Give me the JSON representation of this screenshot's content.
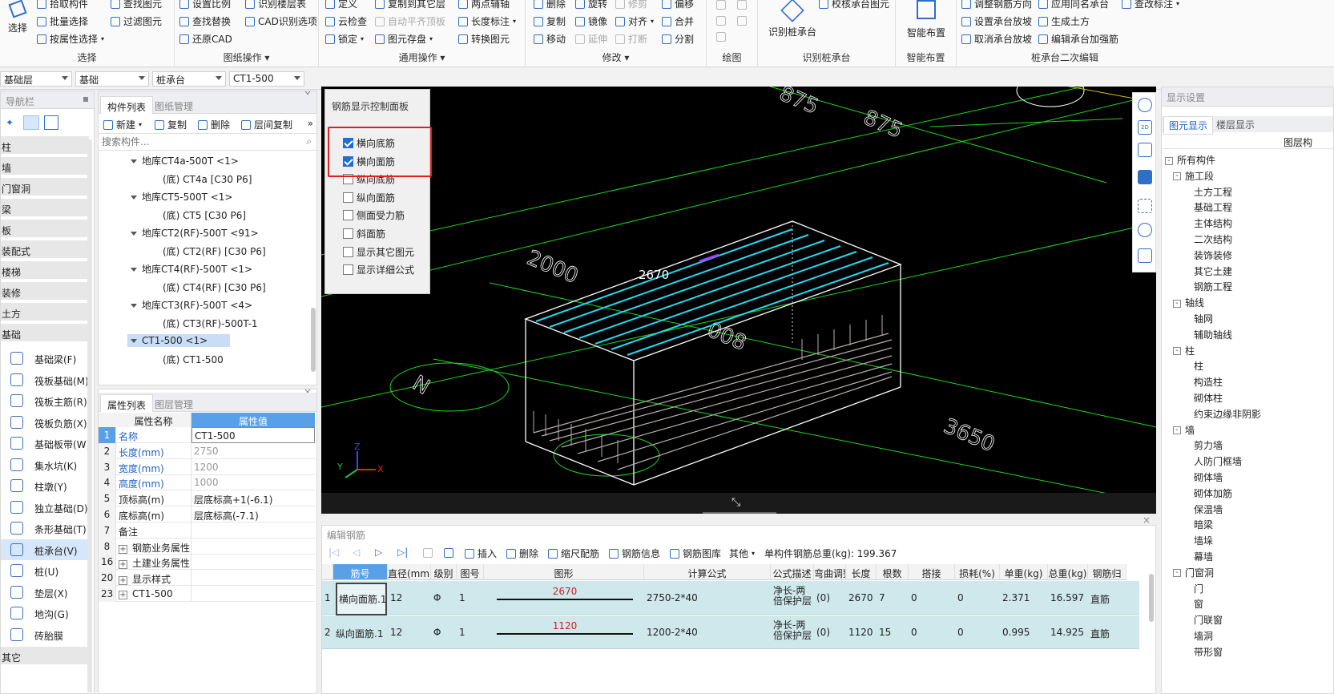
{
  "ribbon": {
    "select": {
      "big_label": "选择",
      "items": [
        "拾取构件",
        "批量选择",
        "按属性选择"
      ],
      "items2": [
        "查找图元",
        "过滤图元"
      ],
      "group": "选择"
    },
    "drawing_ops": {
      "items": [
        "设置比例",
        "查找替换",
        "还原CAD"
      ],
      "items2": [
        "识别楼层表",
        "CAD识别选项"
      ],
      "group": "图纸操作"
    },
    "general_ops": {
      "col1": [
        "定义",
        "云检查",
        "锁定"
      ],
      "col2": [
        "复制到其它层",
        "自动平齐顶板",
        "图元存盘"
      ],
      "col3": [
        "两点辅轴",
        "长度标注",
        "转换图元"
      ],
      "group": "通用操作"
    },
    "modify": {
      "col1": [
        "删除",
        "复制",
        "移动"
      ],
      "col2": [
        "旋转",
        "镜像",
        "延伸"
      ],
      "col3": [
        "修剪",
        "对齐",
        "打断"
      ],
      "col4": [
        "偏移",
        "合并",
        "分割"
      ],
      "group": "修改"
    },
    "draw": {
      "group": "绘图"
    },
    "recognize": {
      "big_label": "识别桩承台",
      "extra": "校核承台图元",
      "group": "识别桩承台"
    },
    "smart": {
      "big_label": "智能布置",
      "group": "智能布置"
    },
    "secondary": {
      "col1": [
        "调整钢筋方向",
        "设置承台放坡",
        "取消承台放坡"
      ],
      "col2": [
        "应用同名承台",
        "生成土方",
        "编辑承台加强筋"
      ],
      "extra": "查改标注",
      "group": "桩承台二次编辑"
    }
  },
  "selectors": [
    "基础层",
    "基础",
    "桩承台",
    "CT1-500"
  ],
  "nav": {
    "title": "导航栏",
    "categories": [
      "柱",
      "墙",
      "门窗洞",
      "梁",
      "板",
      "装配式",
      "楼梯",
      "装修",
      "土方",
      "基础"
    ],
    "items": [
      "基础梁(F)",
      "筏板基础(M)",
      "筏板主筋(R)",
      "筏板负筋(X)",
      "基础板带(W)",
      "集水坑(K)",
      "柱墩(Y)",
      "独立基础(D)",
      "条形基础(T)",
      "桩承台(V)",
      "桩(U)",
      "垫层(X)",
      "地沟(G)",
      "砖胎膜"
    ],
    "last": "其它"
  },
  "component_list": {
    "tabs": [
      "构件列表",
      "图纸管理"
    ],
    "toolbar": [
      "新建",
      "复制",
      "删除",
      "层间复制"
    ],
    "search_placeholder": "搜索构件...",
    "tree": [
      {
        "label": "地库CT4a-500T <1>",
        "child": "(底) CT4a [C30 P6]"
      },
      {
        "label": "地库CT5-500T <1>",
        "child": "(底) CT5 [C30 P6]"
      },
      {
        "label": "地库CT2(RF)-500T <91>",
        "child": "(底) CT2(RF) [C30 P6]"
      },
      {
        "label": "地库CT4(RF)-500T <1>",
        "child": "(底) CT4(RF) [C30 P6]"
      },
      {
        "label": "地库CT3(RF)-500T <4>",
        "child": "(底) CT3(RF)-500T-1"
      },
      {
        "label": "CT1-500 <1>",
        "child": "(底) CT1-500"
      }
    ]
  },
  "properties": {
    "tabs": [
      "属性列表",
      "图层管理"
    ],
    "headers": [
      "属性名称",
      "属性值"
    ],
    "rows": [
      {
        "n": "1",
        "name": "名称",
        "val": "CT1-500"
      },
      {
        "n": "2",
        "name": "长度(mm)",
        "val": "2750"
      },
      {
        "n": "3",
        "name": "宽度(mm)",
        "val": "1200"
      },
      {
        "n": "4",
        "name": "高度(mm)",
        "val": "1000"
      },
      {
        "n": "5",
        "name": "顶标高(m)",
        "val": "层底标高+1(-6.1)"
      },
      {
        "n": "6",
        "name": "底标高(m)",
        "val": "层底标高(-7.1)"
      },
      {
        "n": "7",
        "name": "备注",
        "val": ""
      },
      {
        "n": "8",
        "name": "钢筋业务属性",
        "val": ""
      },
      {
        "n": "16",
        "name": "土建业务属性",
        "val": ""
      },
      {
        "n": "20",
        "name": "显示样式",
        "val": ""
      },
      {
        "n": "23",
        "name": "CT1-500",
        "val": ""
      }
    ]
  },
  "rebar_panel": {
    "title": "钢筋显示控制面板",
    "options": [
      {
        "label": "横向底筋",
        "checked": true
      },
      {
        "label": "横向面筋",
        "checked": true
      },
      {
        "label": "纵向底筋",
        "checked": false
      },
      {
        "label": "纵向面筋",
        "checked": false
      },
      {
        "label": "侧面受力筋",
        "checked": false
      },
      {
        "label": "斜面筋",
        "checked": false
      },
      {
        "label": "显示其它图元",
        "checked": false
      },
      {
        "label": "显示详细公式",
        "checked": false
      }
    ]
  },
  "viewport": {
    "dims": [
      "2670",
      "2000",
      "875",
      "875",
      "008",
      "3650"
    ],
    "axis": {
      "x": "X",
      "y": "Y",
      "z": "Z"
    }
  },
  "view_tools": [
    "2D"
  ],
  "editor": {
    "title": "编辑钢筋",
    "toolbar": [
      "插入",
      "删除",
      "缩尺配筋",
      "钢筋信息",
      "钢筋图库",
      "其他"
    ],
    "total_label": "单构件钢筋总重(kg): 199.367",
    "headers": [
      "筋号",
      "直径(mm)",
      "级别",
      "图号",
      "图形",
      "计算公式",
      "公式描述",
      "弯曲调整",
      "长度",
      "根数",
      "搭接",
      "损耗(%)",
      "单重(kg)",
      "总重(kg)",
      "钢筋归"
    ],
    "rows": [
      {
        "n": "1",
        "name": "横向面筋.1",
        "dia": "12",
        "grade": "Φ",
        "fig": "1",
        "shape": "2670",
        "formula": "2750-2*40",
        "desc": "净长-两倍保护层",
        "bend": "(0)",
        "len": "2670",
        "count": "7",
        "lap": "0",
        "loss": "0",
        "unit": "2.371",
        "total": "16.597",
        "type": "直筋"
      },
      {
        "n": "2",
        "name": "纵向面筋.1",
        "dia": "12",
        "grade": "Φ",
        "fig": "1",
        "shape": "1120",
        "formula": "1200-2*40",
        "desc": "净长-两倍保护层",
        "bend": "(0)",
        "len": "1120",
        "count": "15",
        "lap": "0",
        "loss": "0",
        "unit": "0.995",
        "total": "14.925",
        "type": "直筋"
      }
    ]
  },
  "settings": {
    "title": "显示设置",
    "tabs": [
      "图元显示",
      "楼层显示"
    ],
    "col_header": "图层构",
    "tree": [
      {
        "t": "所有构件",
        "lvl": 0,
        "box": "-"
      },
      {
        "t": "施工段",
        "lvl": 1,
        "box": "-"
      },
      {
        "t": "土方工程",
        "lvl": 2
      },
      {
        "t": "基础工程",
        "lvl": 2
      },
      {
        "t": "主体结构",
        "lvl": 2
      },
      {
        "t": "二次结构",
        "lvl": 2
      },
      {
        "t": "装饰装修",
        "lvl": 2
      },
      {
        "t": "其它土建",
        "lvl": 2
      },
      {
        "t": "钢筋工程",
        "lvl": 2
      },
      {
        "t": "轴线",
        "lvl": 1,
        "box": "-"
      },
      {
        "t": "轴网",
        "lvl": 2
      },
      {
        "t": "辅助轴线",
        "lvl": 2
      },
      {
        "t": "柱",
        "lvl": 1,
        "box": "-"
      },
      {
        "t": "柱",
        "lvl": 2
      },
      {
        "t": "构造柱",
        "lvl": 2
      },
      {
        "t": "砌体柱",
        "lvl": 2
      },
      {
        "t": "约束边缘非阴影",
        "lvl": 2
      },
      {
        "t": "墙",
        "lvl": 1,
        "box": "-"
      },
      {
        "t": "剪力墙",
        "lvl": 2
      },
      {
        "t": "人防门框墙",
        "lvl": 2
      },
      {
        "t": "砌体墙",
        "lvl": 2
      },
      {
        "t": "砌体加筋",
        "lvl": 2
      },
      {
        "t": "保温墙",
        "lvl": 2
      },
      {
        "t": "暗梁",
        "lvl": 2
      },
      {
        "t": "墙垛",
        "lvl": 2
      },
      {
        "t": "幕墙",
        "lvl": 2
      },
      {
        "t": "门窗洞",
        "lvl": 1,
        "box": "-"
      },
      {
        "t": "门",
        "lvl": 2
      },
      {
        "t": "窗",
        "lvl": 2
      },
      {
        "t": "门联窗",
        "lvl": 2
      },
      {
        "t": "墙洞",
        "lvl": 2
      },
      {
        "t": "带形窗",
        "lvl": 2
      }
    ]
  },
  "colors": {
    "accent": "#2f6fc8",
    "highlight": "#e02020",
    "viewport_bg": "#000000",
    "green": "#1fd51f",
    "cyan": "#24d8f0"
  }
}
